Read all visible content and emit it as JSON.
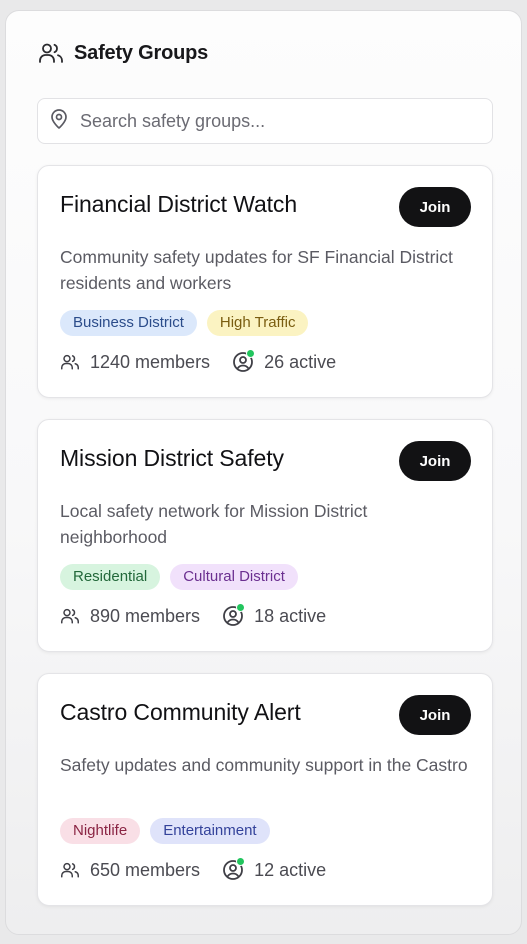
{
  "header": {
    "title": "Safety Groups",
    "icon": "users-icon"
  },
  "search": {
    "placeholder": "Search safety groups...",
    "value": "",
    "icon": "map-pin-icon"
  },
  "groups": [
    {
      "name": "Financial District Watch",
      "join_label": "Join",
      "description": "Community safety updates for SF Financial District residents and workers",
      "tags": [
        {
          "label": "Business District",
          "bg": "#dbe8fb",
          "fg": "#2b4c8a"
        },
        {
          "label": "High Traffic",
          "bg": "#fbf3c2",
          "fg": "#7a5d10"
        }
      ],
      "members": "1240 members",
      "active": "26 active"
    },
    {
      "name": "Mission District Safety",
      "join_label": "Join",
      "description": "Local safety network for Mission District neighborhood",
      "tags": [
        {
          "label": "Residential",
          "bg": "#d7f4df",
          "fg": "#22683a"
        },
        {
          "label": "Cultural District",
          "bg": "#f1e1fb",
          "fg": "#6b2f90"
        }
      ],
      "members": "890 members",
      "active": "18 active"
    },
    {
      "name": "Castro Community Alert",
      "join_label": "Join",
      "description": "Safety updates and community support in the Castro",
      "tags": [
        {
          "label": "Nightlife",
          "bg": "#f9dfe6",
          "fg": "#8a2443"
        },
        {
          "label": "Entertainment",
          "bg": "#dfe3fa",
          "fg": "#33429a"
        }
      ],
      "members": "650 members",
      "active": "12 active"
    }
  ],
  "colors": {
    "join_bg": "#121214",
    "live_dot": "#22c55e"
  }
}
